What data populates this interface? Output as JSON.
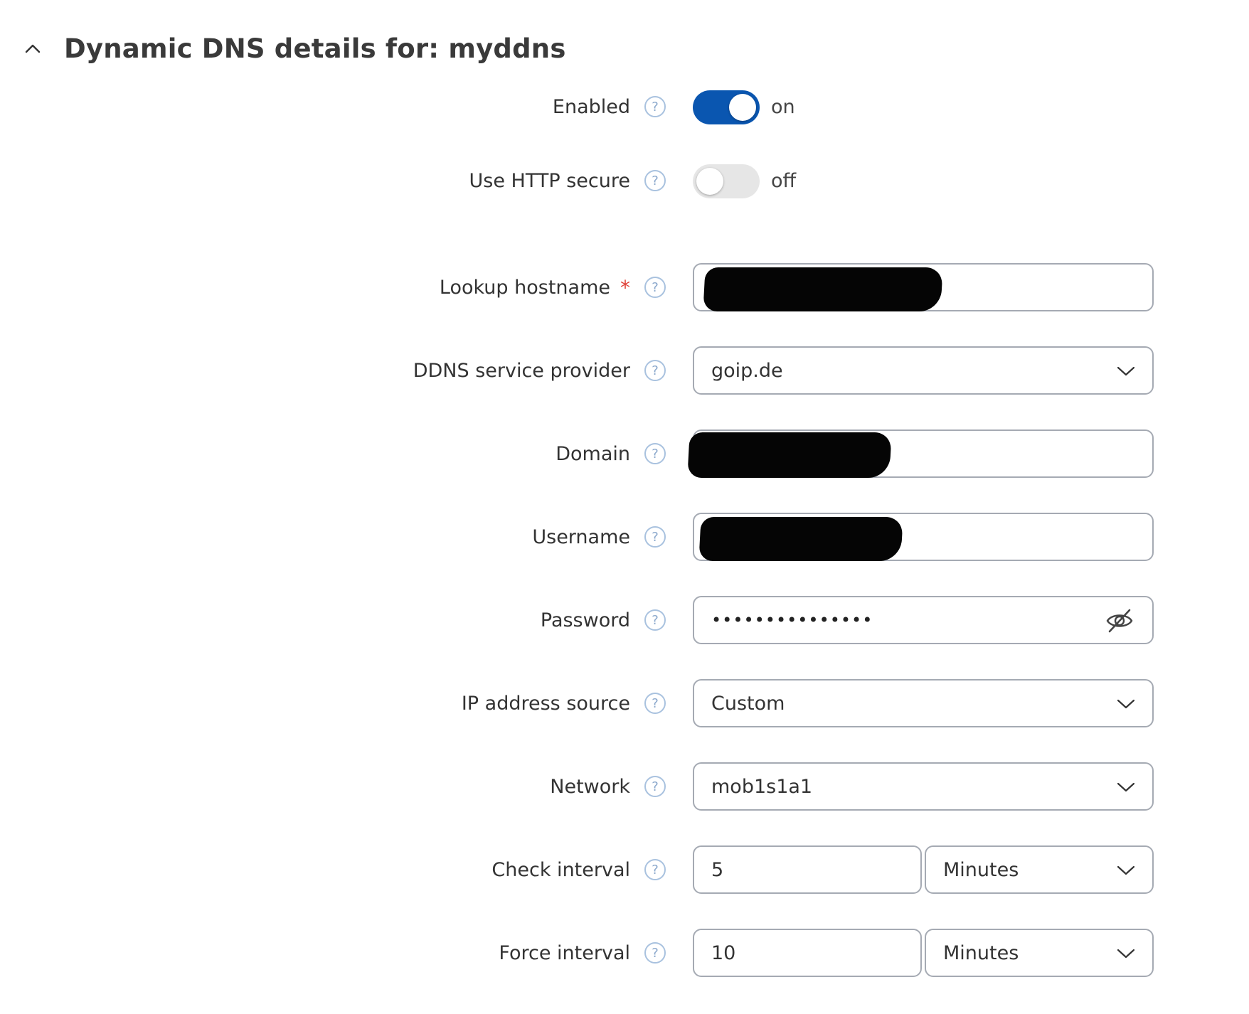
{
  "section": {
    "title": "Dynamic DNS details for: myddns"
  },
  "fields": {
    "enabled": {
      "label": "Enabled",
      "state": "on",
      "value": true
    },
    "https": {
      "label": "Use HTTP secure",
      "state": "off",
      "value": false
    },
    "lookup_hostname": {
      "label": "Lookup hostname",
      "required_mark": "*",
      "value": ""
    },
    "provider": {
      "label": "DDNS service provider",
      "value": "goip.de"
    },
    "domain": {
      "label": "Domain",
      "value": ""
    },
    "username": {
      "label": "Username",
      "value": ""
    },
    "password": {
      "label": "Password",
      "value": "•••••••••••••••"
    },
    "ip_source": {
      "label": "IP address source",
      "value": "Custom"
    },
    "network": {
      "label": "Network",
      "value": "mob1s1a1"
    },
    "check_interval": {
      "label": "Check interval",
      "value": "5",
      "unit": "Minutes"
    },
    "force_interval": {
      "label": "Force interval",
      "value": "10",
      "unit": "Minutes"
    }
  },
  "help_glyph": "?",
  "icons": {
    "collapse": "chevron-up-icon",
    "dropdown": "chevron-down-icon",
    "help": "question-circle-icon",
    "password_toggle": "eye-slash-icon"
  },
  "colors": {
    "toggle_on": "#0a56b0",
    "toggle_off": "#e6e6e6",
    "required": "#e0433a",
    "help_icon": "#a9c2df",
    "border": "#a5aab3"
  }
}
